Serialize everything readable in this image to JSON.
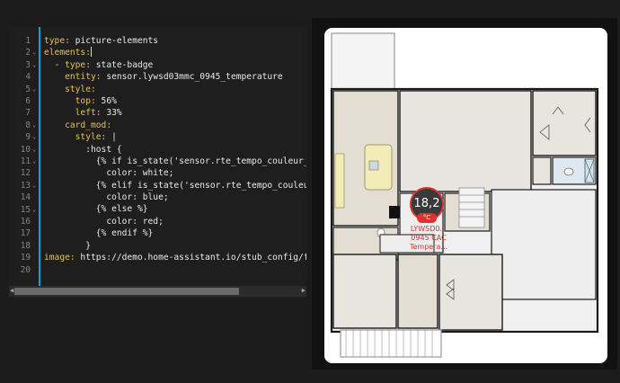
{
  "editor": {
    "line_numbers": [
      "1",
      "2",
      "3",
      "4",
      "5",
      "6",
      "7",
      "8",
      "9",
      "10",
      "11",
      "12",
      "13",
      "14",
      "15",
      "16",
      "17",
      "18",
      "19",
      "20"
    ],
    "fold_lines": [
      2,
      3,
      5,
      8,
      9,
      10,
      11,
      13,
      15
    ],
    "lines": [
      {
        "indent": "",
        "key": "type:",
        "value": " picture-elements"
      },
      {
        "indent": "",
        "key": "elements:",
        "value": "",
        "cursor": true
      },
      {
        "indent": "  - ",
        "key": "type:",
        "value": " state-badge"
      },
      {
        "indent": "    ",
        "key": "entity:",
        "value": " sensor.lywsd03mmc_0945_temperature"
      },
      {
        "indent": "    ",
        "key": "style:",
        "value": ""
      },
      {
        "indent": "      ",
        "key": "top:",
        "value": " 56%"
      },
      {
        "indent": "      ",
        "key": "left:",
        "value": " 33%"
      },
      {
        "indent": "    ",
        "key": "card_mod:",
        "value": ""
      },
      {
        "indent": "      ",
        "key": "style:",
        "value": " |"
      },
      {
        "indent": "        ",
        "key": "",
        "value": ":host {"
      },
      {
        "indent": "          ",
        "key": "",
        "value": "{% if is_state('sensor.rte_tempo_couleur_actu"
      },
      {
        "indent": "            ",
        "key": "",
        "value": "color: white;"
      },
      {
        "indent": "          ",
        "key": "",
        "value": "{% elif is_state('sensor.rte_tempo_couleur_ac"
      },
      {
        "indent": "            ",
        "key": "",
        "value": "color: blue;"
      },
      {
        "indent": "          ",
        "key": "",
        "value": "{% else %}"
      },
      {
        "indent": "            ",
        "key": "",
        "value": "color: red;"
      },
      {
        "indent": "          ",
        "key": "",
        "value": "{% endif %}"
      },
      {
        "indent": "        ",
        "key": "",
        "value": "}"
      },
      {
        "indent": "",
        "key": "image:",
        "value": " https://demo.home-assistant.io/stub_config/floor"
      },
      {
        "indent": "",
        "key": "",
        "value": ""
      }
    ]
  },
  "badge": {
    "value": "18,2",
    "unit": "°C",
    "label_lines": [
      "LYWSD0...",
      "0945 CAC",
      "Tempera..."
    ]
  },
  "colors": {
    "badge_border": "#e03030",
    "yaml_key": "#e8c34a",
    "gutter_accent": "#0aa8d8"
  }
}
